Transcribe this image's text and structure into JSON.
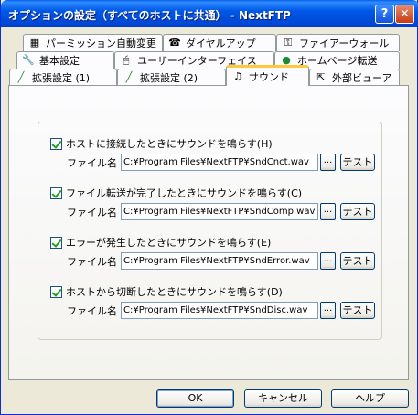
{
  "window": {
    "title": "オプションの設定（すべてのホストに共通） - NextFTP",
    "help_glyph": "?",
    "close_glyph": "✕"
  },
  "tabs": {
    "row1": [
      {
        "label": "パーミッション自動変更",
        "icon": "chmod-icon"
      },
      {
        "label": "ダイヤルアップ",
        "icon": "phone-icon"
      },
      {
        "label": "ファイアーウォール",
        "icon": "key-icon"
      }
    ],
    "row2": [
      {
        "label": "基本設定",
        "icon": "wrench-icon"
      },
      {
        "label": "ユーザーインターフェイス",
        "icon": "mouse-icon"
      },
      {
        "label": "ホームページ転送",
        "icon": "globe-icon"
      }
    ],
    "row3": [
      {
        "label": "拡張設定 (1)",
        "icon": "brush-icon"
      },
      {
        "label": "拡張設定 (2)",
        "icon": "brush-icon"
      },
      {
        "label": "サウンド",
        "icon": "music-note-icon",
        "active": true
      },
      {
        "label": "外部ビューア",
        "icon": "viewer-icon"
      }
    ]
  },
  "sound": {
    "file_label": "ファイル名",
    "browse_label": "...",
    "test_label": "テスト",
    "items": [
      {
        "label": "ホストに接続したときにサウンドを鳴らす(H)",
        "checked": true,
        "path": "C:¥Program Files¥NextFTP¥SndCnct.wav"
      },
      {
        "label": "ファイル転送が完了したときにサウンドを鳴らす(C)",
        "checked": true,
        "path": "C:¥Program Files¥NextFTP¥SndComp.wav"
      },
      {
        "label": "エラーが発生したときにサウンドを鳴らす(E)",
        "checked": true,
        "path": "C:¥Program Files¥NextFTP¥SndError.wav"
      },
      {
        "label": "ホストから切断したときにサウンドを鳴らす(D)",
        "checked": true,
        "path": "C:¥Program Files¥NextFTP¥SndDisc.wav"
      }
    ]
  },
  "buttons": {
    "ok": "OK",
    "cancel": "キャンセル",
    "help": "ヘルプ"
  }
}
